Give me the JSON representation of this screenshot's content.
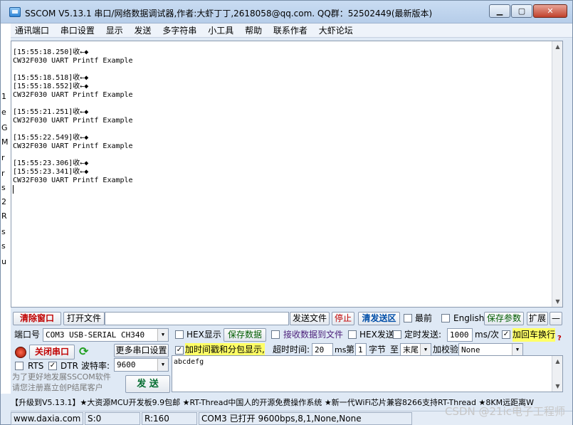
{
  "window": {
    "title": "SSCOM V5.13.1 串口/网络数据调试器,作者:大虾丁丁,2618058@qq.com. QQ群：52502449(最新版本)",
    "minimize_label": "▁",
    "maximize_label": "▢",
    "close_label": "✕"
  },
  "menu": [
    "通讯端口",
    "串口设置",
    "显示",
    "发送",
    "多字符串",
    "小工具",
    "帮助",
    "联系作者",
    "大虾论坛"
  ],
  "receive_log": "[15:55:18.250]收←◆\nCW32F030 UART Printf Example\n\n[15:55:18.518]收←◆\n[15:55:18.552]收←◆\nCW32F030 UART Printf Example\n\n[15:55:21.251]收←◆\nCW32F030 UART Printf Example\n\n[15:55:22.549]收←◆\nCW32F030 UART Printf Example\n\n[15:55:23.306]收←◆\n[15:55:23.341]收←◆\nCW32F030 UART Printf Example",
  "left_strip": [
    "1",
    "e",
    "G",
    "M",
    "r",
    "r",
    "s",
    "2",
    "R",
    "s",
    "s",
    "u"
  ],
  "controls": {
    "clear_window": "清除窗口",
    "open_file": "打开文件",
    "file_path": "",
    "send_file": "发送文件",
    "stop": "停止",
    "clear_send": "清发送区",
    "topmost": "最前",
    "english": "English",
    "save_params": "保存参数",
    "expand": "扩展",
    "collapse": "—",
    "port_label": "端口号",
    "port_value": "COM3 USB-SERIAL CH340",
    "hex_display": "HEX显示",
    "save_data": "保存数据",
    "recv_to_file": "接收数据到文件",
    "hex_send": "HEX发送",
    "timed_send": "定时发送:",
    "interval_value": "1000",
    "interval_unit": "ms/次",
    "add_crlf": "加回车换行",
    "close_port": "关闭串口",
    "more_settings": "更多串口设置",
    "timestamp_label": "加时间戳和分包显示,",
    "timeout_label": "超时时间:",
    "timeout_value": "20",
    "timeout_unit": "ms",
    "byte_prefix": "第",
    "byte_index": "1",
    "byte_suffix": "字节",
    "to_label": "至",
    "end_value": "末尾",
    "checksum_label": "加校验",
    "checksum_value": "None",
    "rts": "RTS",
    "dtr": "DTR",
    "baud_label": "波特率:",
    "baud_value": "9600",
    "send_text": "abcdefg",
    "send_button": "发 送",
    "promo_line1": "为了更好地发展SSCOM软件",
    "promo_line2": "请您注册嘉立创P结尾客户"
  },
  "ticker": "【升级到V5.13.1】★大资源MCU开发板9.9包邮 ★RT-Thread中国人的开源免费操作系统 ★新一代WiFi芯片兼容8266支持RT-Thread ★8KM远距离W",
  "status": {
    "website": "www.daxia.com",
    "sent": "S:0",
    "received": "R:160",
    "port_state": "COM3 已打开  9600bps,8,1,None,None"
  },
  "watermark": "CSDN @21ic电子工程师"
}
